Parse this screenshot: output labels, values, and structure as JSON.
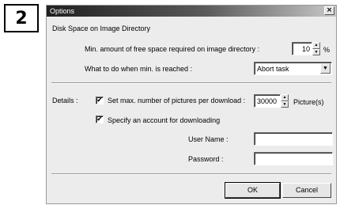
{
  "step_number": "2",
  "dialog": {
    "title": "Options",
    "close_glyph": "×",
    "section_heading": "Disk Space on Image Directory",
    "min_free_label": "Min. amount of free space required on image directory :",
    "min_free_value": "10",
    "min_free_unit": "%",
    "on_min_label": "What to do when min. is reached :",
    "on_min_value": "Abort task",
    "details_label": "Details :",
    "max_pictures_label": "Set max. number of pictures per download :",
    "max_pictures_checked": true,
    "max_pictures_value": "30000",
    "max_pictures_unit": "Picture(s)",
    "account_label": "Specify an account for downloading",
    "account_checked": true,
    "user_name_label": "User Name :",
    "user_name_value": "",
    "password_label": "Password :",
    "password_value": "",
    "ok_label": "OK",
    "cancel_label": "Cancel"
  }
}
